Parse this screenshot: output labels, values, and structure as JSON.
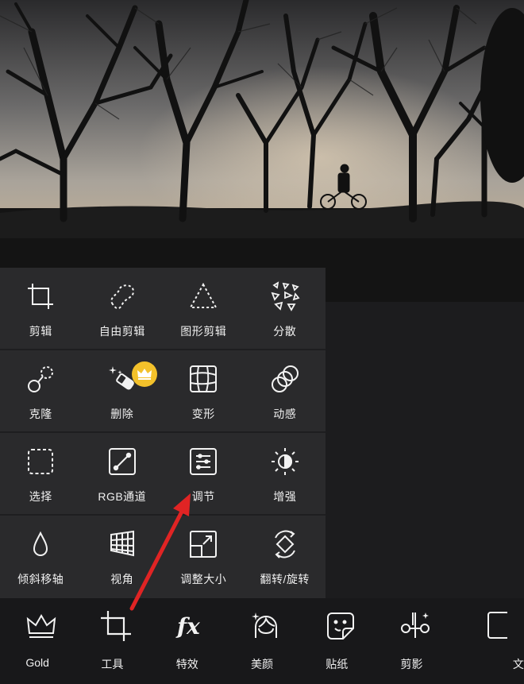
{
  "tools_panel": {
    "rows": [
      [
        {
          "label": "剪辑",
          "icon": "crop-icon"
        },
        {
          "label": "自由剪辑",
          "icon": "freeform-crop-icon"
        },
        {
          "label": "图形剪辑",
          "icon": "shape-crop-icon"
        },
        {
          "label": "分散",
          "icon": "disperse-icon"
        }
      ],
      [
        {
          "label": "克隆",
          "icon": "clone-icon"
        },
        {
          "label": "删除",
          "icon": "eraser-sparkle-icon",
          "premium": true
        },
        {
          "label": "变形",
          "icon": "warp-grid-icon"
        },
        {
          "label": "动感",
          "icon": "motion-icon"
        }
      ],
      [
        {
          "label": "选择",
          "icon": "selection-icon"
        },
        {
          "label": "RGB通道",
          "icon": "rgb-curve-icon"
        },
        {
          "label": "调节",
          "icon": "adjust-list-icon"
        },
        {
          "label": "增强",
          "icon": "enhance-sun-icon"
        }
      ],
      [
        {
          "label": "倾斜移轴",
          "icon": "tilt-shift-drop-icon"
        },
        {
          "label": "视角",
          "icon": "perspective-icon"
        },
        {
          "label": "调整大小",
          "icon": "resize-icon"
        },
        {
          "label": "翻转/旋转",
          "icon": "flip-rotate-icon"
        }
      ]
    ]
  },
  "bottom_bar": {
    "items": [
      {
        "label": "Gold",
        "icon": "crown-icon"
      },
      {
        "label": "工具",
        "icon": "crop-tool-icon"
      },
      {
        "label": "特效",
        "icon": "fx-icon"
      },
      {
        "label": "美颜",
        "icon": "beauty-face-icon"
      },
      {
        "label": "贴纸",
        "icon": "sticker-icon"
      },
      {
        "label": "剪影",
        "icon": "cutout-scissors-icon"
      },
      {
        "label": "文",
        "icon": "text-icon"
      }
    ]
  },
  "colors": {
    "panel_bg": "#2a2a2c",
    "bottom_bar_bg": "#18181a",
    "premium_badge": "#f3c12b",
    "annotation_arrow": "#e02424"
  }
}
